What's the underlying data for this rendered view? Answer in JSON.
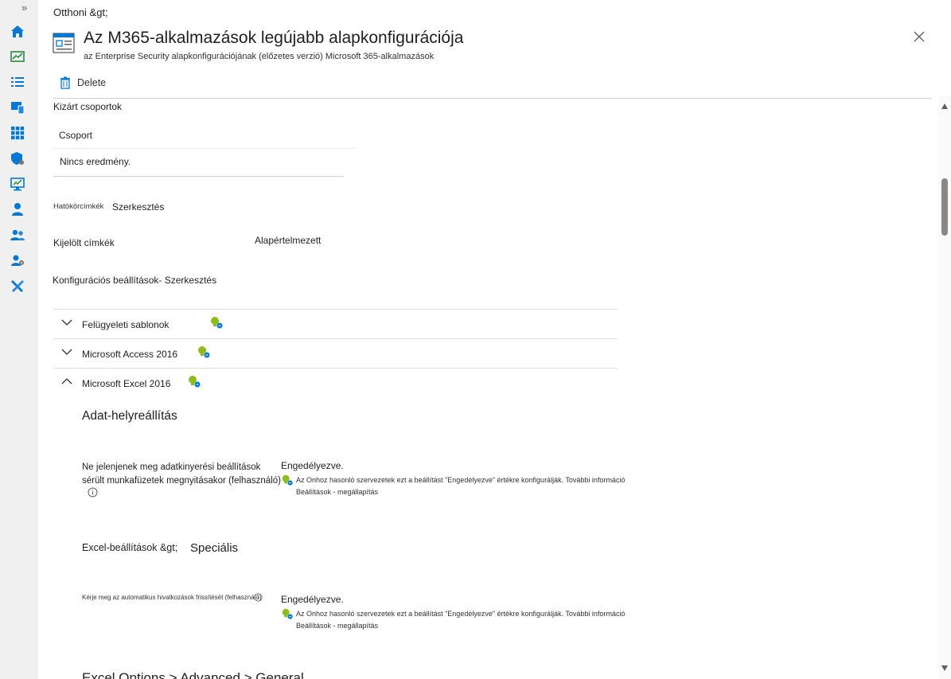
{
  "breadcrumb": "Otthoni &gt;",
  "header": {
    "title": "Az M365-alkalmazások legújabb alapkonfigurációja",
    "subtitle": "az Enterprise Security alapkonfigurációjának (előzetes verzió) Microsoft 365-alkalmazások"
  },
  "commands": {
    "delete": "Delete"
  },
  "excluded": {
    "heading": "Kizárt csoportok",
    "column": "Csoport",
    "empty": "Nincs eredmény."
  },
  "scope": {
    "label": "Hatókörcímkék",
    "edit": "Szerkesztés"
  },
  "selected_tags": {
    "label": "Kijelölt címkék",
    "value": "Alapértelmezett"
  },
  "config": {
    "label": "Konfigurációs beállítások- Szerkesztés"
  },
  "accordion": [
    {
      "label": "Felügyeleti sablonok"
    },
    {
      "label": "Microsoft Access 2016"
    },
    {
      "label": "Microsoft Excel 2016"
    }
  ],
  "excel": {
    "section": "Adat-helyreállítás",
    "setting1_line1": "Ne jelenjenek meg adatkinyerési beállítások",
    "setting1_line2": "sérült munkafüzetek megnyitásakor (felhasználó)",
    "setting1_value": "Engedélyezve.",
    "setting1_rec": "Az Onhoz hasonló szervezetek ezt a beállítást \"Engedélyezve\" értékre konfigurálják. További információ",
    "setting1_rec2": "Beállítások - megállapítás",
    "path_prefix": "Excel-beállítások &gt;",
    "path_suffix": "Speciális",
    "setting2_label": "Kérje meg az automatikus hivatkozások frissítését (felhasználó)",
    "setting2_value": "Engedélyezve.",
    "setting2_rec": "Az Onhoz hasonló szervezetek ezt a beállítást \"Engedélyezve\" értékre konfigurálják. További információ",
    "setting2_rec2": "Beállítások - megállapítás",
    "cutoff_text": "Excel Options > Advanced > General"
  },
  "colors": {
    "accent": "#0078d4",
    "bulb": "#8cbd18"
  }
}
